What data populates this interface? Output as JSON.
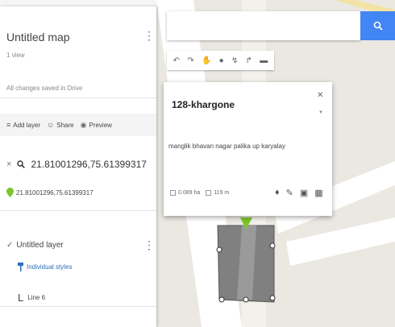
{
  "map_title": "Untitled map",
  "map_views": "1 view",
  "saved_status": "All changes saved in Drive",
  "more_icon": "⋮",
  "actions": {
    "add_layer": "Add layer",
    "share": "Share",
    "preview": "Preview"
  },
  "search": {
    "query": "21.81001296,75.61399317",
    "close_symbol": "×",
    "result": "21.81001296,75.61399317"
  },
  "layer": {
    "name": "Untitled layer",
    "styles_label": "Individual styles",
    "line_label": "Line 6"
  },
  "popup": {
    "title": "128-khargone",
    "description": "manglik bhavan nagar palika up karyalay",
    "area": "0.089 ha",
    "perimeter": "119 m"
  },
  "colors": {
    "search_button": "#4285f4",
    "pin_green": "#7cc52a",
    "polygon_fill": "#808080"
  }
}
